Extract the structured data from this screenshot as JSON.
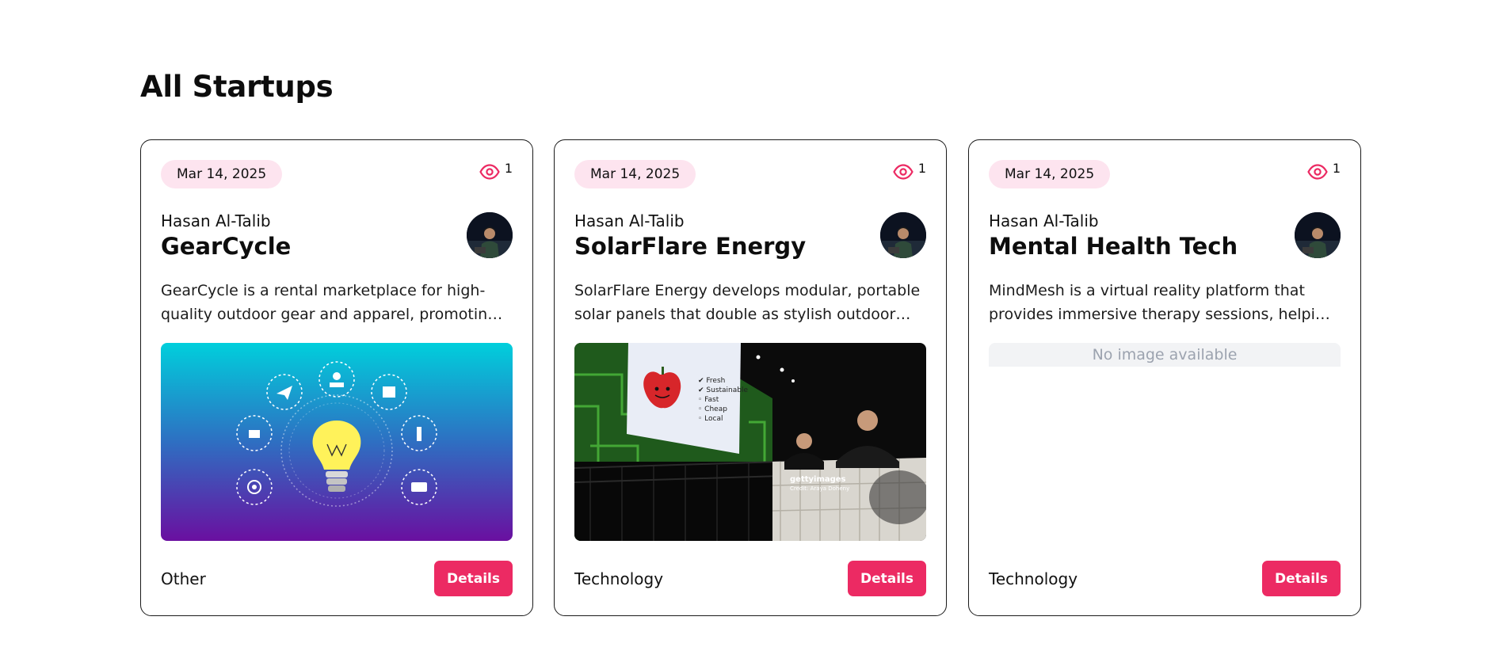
{
  "section_title": "All Startups",
  "colors": {
    "accent": "#ec2a63",
    "badge_bg": "#fde4ef",
    "border": "#1a1a1a"
  },
  "cards": [
    {
      "date": "Mar 14, 2025",
      "views": "1",
      "author": "Hasan Al-Talib",
      "title": "GearCycle",
      "description": "GearCycle is a rental marketplace for high-quality outdoor gear and apparel, promoting sustainable adventures.",
      "image": "lightbulb-illustration",
      "category": "Other",
      "button": "Details"
    },
    {
      "date": "Mar 14, 2025",
      "views": "1",
      "author": "Hasan Al-Talib",
      "title": "SolarFlare Energy",
      "description": "SolarFlare Energy develops modular, portable solar panels that double as stylish outdoor furniture.",
      "image": "conference-stage-photo",
      "image_caption": "gettyimages Credit: Araya Doheny",
      "category": "Technology",
      "button": "Details"
    },
    {
      "date": "Mar 14, 2025",
      "views": "1",
      "author": "Hasan Al-Talib",
      "title": "Mental Health Tech",
      "description": "MindMesh is a virtual reality platform that provides immersive therapy sessions, helping users manage anxiety.",
      "no_image_text": "No image available",
      "category": "Technology",
      "button": "Details"
    }
  ]
}
